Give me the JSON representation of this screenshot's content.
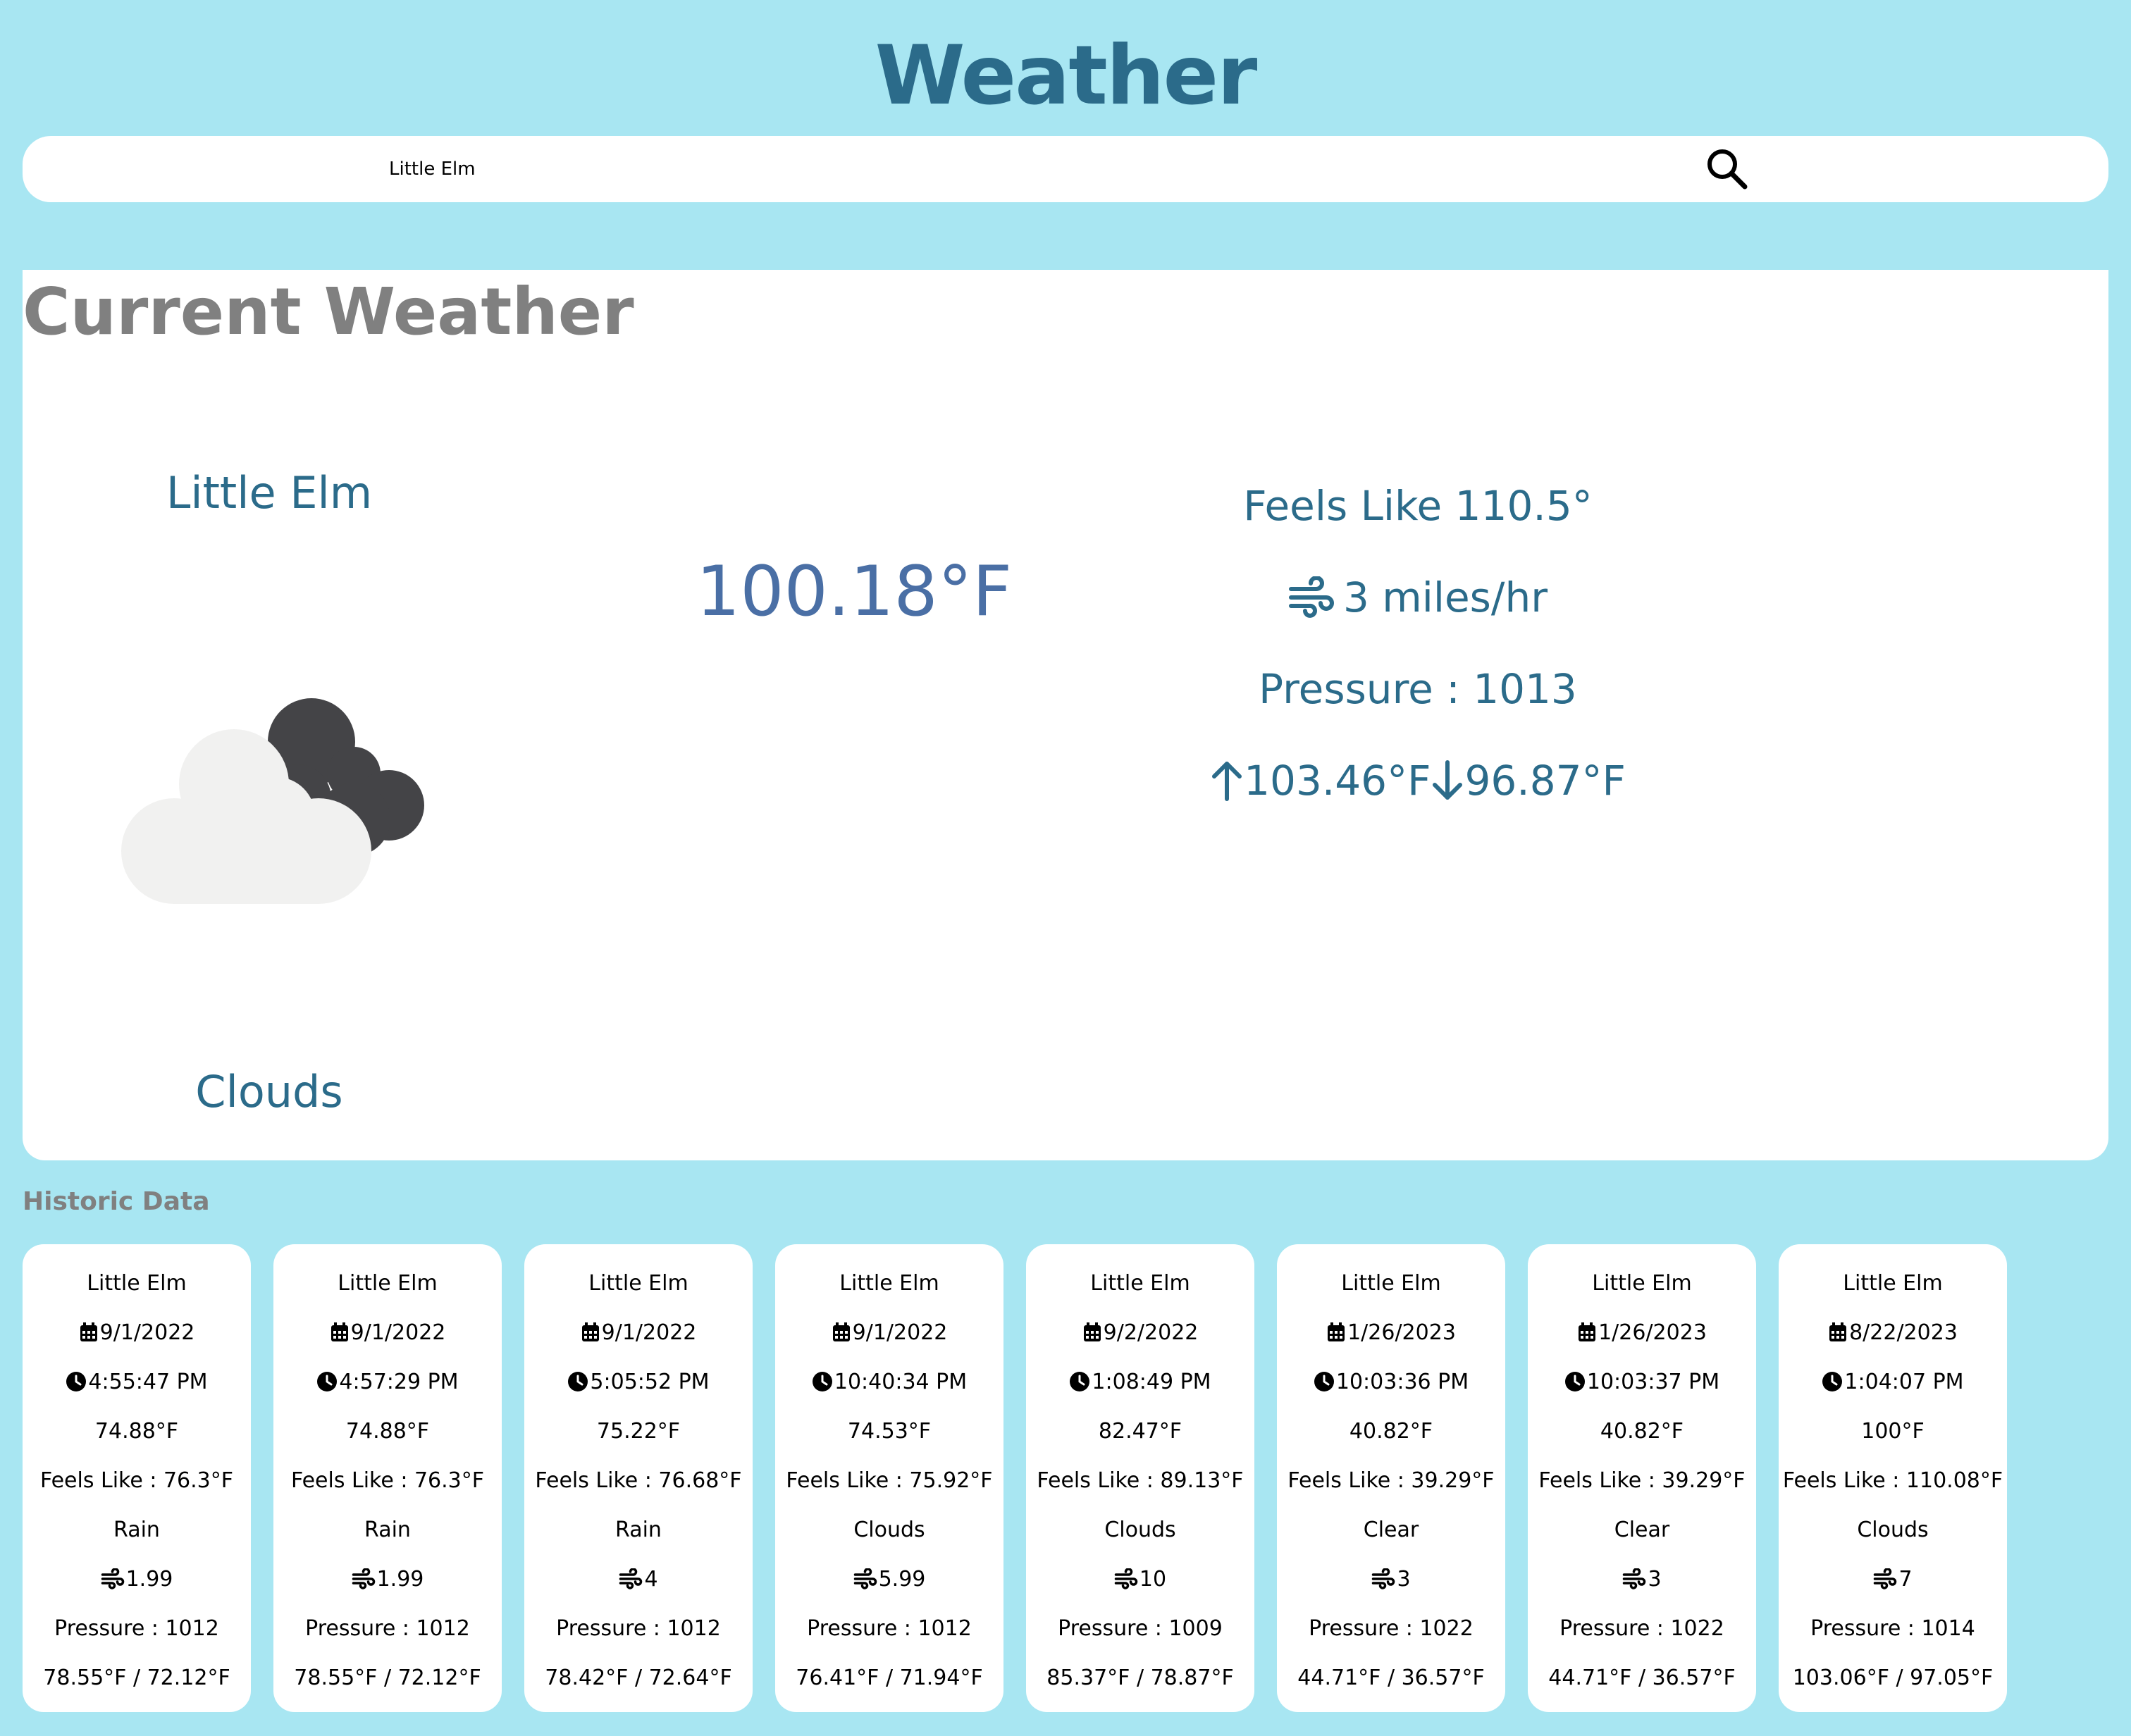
{
  "header": {
    "title": "Weather"
  },
  "search": {
    "value": "Little Elm",
    "icon": "search-icon"
  },
  "current": {
    "section_title": "Current Weather",
    "city": "Little Elm",
    "condition": "Clouds",
    "condition_icon": "clouds-icon",
    "temperature": "100.18°F",
    "feels_like": "Feels Like 110.5°",
    "wind": "3 miles/hr",
    "pressure": "Pressure : 1013",
    "high": "103.46°F",
    "low": "96.87°F"
  },
  "historic": {
    "title": "Historic Data",
    "cards": [
      {
        "city": "Little Elm",
        "date": "9/1/2022",
        "time": "4:55:47 PM",
        "temp": "74.88°F",
        "feels": "Feels Like : 76.3°F",
        "condition": "Rain",
        "wind": "1.99",
        "pressure": "Pressure : 1012",
        "range": "78.55°F / 72.12°F"
      },
      {
        "city": "Little Elm",
        "date": "9/1/2022",
        "time": "4:57:29 PM",
        "temp": "74.88°F",
        "feels": "Feels Like : 76.3°F",
        "condition": "Rain",
        "wind": "1.99",
        "pressure": "Pressure : 1012",
        "range": "78.55°F / 72.12°F"
      },
      {
        "city": "Little Elm",
        "date": "9/1/2022",
        "time": "5:05:52 PM",
        "temp": "75.22°F",
        "feels": "Feels Like : 76.68°F",
        "condition": "Rain",
        "wind": "4",
        "pressure": "Pressure : 1012",
        "range": "78.42°F / 72.64°F"
      },
      {
        "city": "Little Elm",
        "date": "9/1/2022",
        "time": "10:40:34 PM",
        "temp": "74.53°F",
        "feels": "Feels Like : 75.92°F",
        "condition": "Clouds",
        "wind": "5.99",
        "pressure": "Pressure : 1012",
        "range": "76.41°F / 71.94°F"
      },
      {
        "city": "Little Elm",
        "date": "9/2/2022",
        "time": "1:08:49 PM",
        "temp": "82.47°F",
        "feels": "Feels Like : 89.13°F",
        "condition": "Clouds",
        "wind": "10",
        "pressure": "Pressure : 1009",
        "range": "85.37°F / 78.87°F"
      },
      {
        "city": "Little Elm",
        "date": "1/26/2023",
        "time": "10:03:36 PM",
        "temp": "40.82°F",
        "feels": "Feels Like : 39.29°F",
        "condition": "Clear",
        "wind": "3",
        "pressure": "Pressure : 1022",
        "range": "44.71°F / 36.57°F"
      },
      {
        "city": "Little Elm",
        "date": "1/26/2023",
        "time": "10:03:37 PM",
        "temp": "40.82°F",
        "feels": "Feels Like : 39.29°F",
        "condition": "Clear",
        "wind": "3",
        "pressure": "Pressure : 1022",
        "range": "44.71°F / 36.57°F"
      },
      {
        "city": "Little Elm",
        "date": "8/22/2023",
        "time": "1:04:07 PM",
        "temp": "100°F",
        "feels": "Feels Like : 110.08°F",
        "condition": "Clouds",
        "wind": "7",
        "pressure": "Pressure : 1014",
        "range": "103.06°F / 97.05°F"
      }
    ]
  },
  "colors": {
    "background": "#a8e6f2",
    "accent": "#2b6b8a",
    "temperature": "#4a6fa5",
    "muted": "#808080"
  }
}
